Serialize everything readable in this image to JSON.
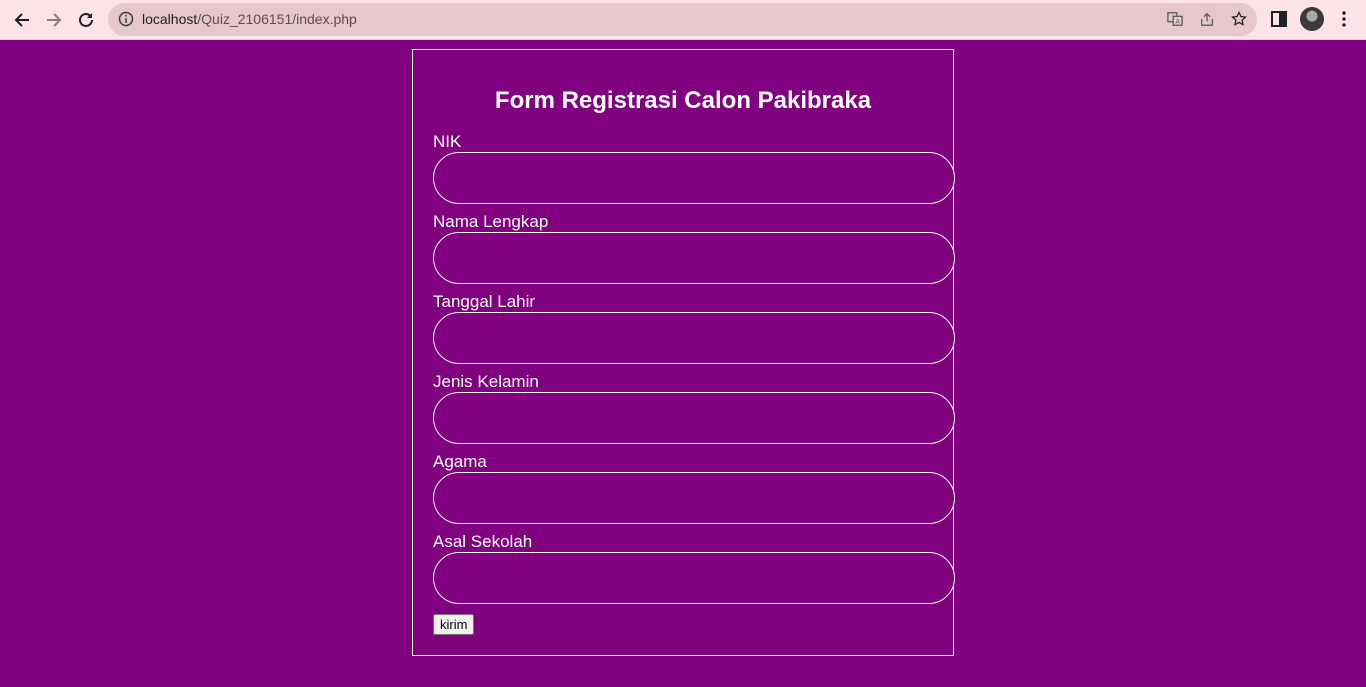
{
  "browser": {
    "url_host": "localhost",
    "url_path": "/Quiz_2106151/index.php"
  },
  "form": {
    "title": "Form Registrasi Calon Pakibraka",
    "fields": [
      {
        "label": "NIK",
        "value": ""
      },
      {
        "label": "Nama Lengkap",
        "value": ""
      },
      {
        "label": "Tanggal Lahir",
        "value": ""
      },
      {
        "label": "Jenis Kelamin",
        "value": ""
      },
      {
        "label": "Agama",
        "value": ""
      },
      {
        "label": "Asal Sekolah",
        "value": ""
      }
    ],
    "submit_label": "kirim"
  },
  "colors": {
    "page_background": "#800080",
    "chrome_background": "#fbe3e8",
    "omnibox_background": "#e5c7cc",
    "border": "#ffffff"
  },
  "icons": [
    "back-arrow-icon",
    "forward-arrow-icon",
    "reload-icon",
    "info-icon",
    "translate-icon",
    "share-icon",
    "star-icon",
    "side-panel-icon",
    "avatar",
    "menu-icon"
  ]
}
